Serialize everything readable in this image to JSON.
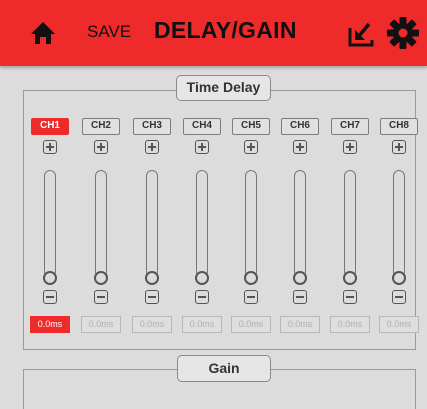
{
  "header": {
    "save_label": "SAVE",
    "title": "DELAY/GAIN",
    "icons": [
      "home-icon",
      "import-icon",
      "gear-icon"
    ],
    "accent_color": "#ee2a2a"
  },
  "time_delay": {
    "label": "Time Delay",
    "channels": [
      {
        "label": "CH1",
        "value": "0.0ms",
        "active": true,
        "level": 0
      },
      {
        "label": "CH2",
        "value": "0.0ms",
        "active": false,
        "level": 0
      },
      {
        "label": "CH3",
        "value": "0.0ms",
        "active": false,
        "level": 0
      },
      {
        "label": "CH4",
        "value": "0.0ms",
        "active": false,
        "level": 0
      },
      {
        "label": "CH5",
        "value": "0.0ms",
        "active": false,
        "level": 0
      },
      {
        "label": "CH6",
        "value": "0.0ms",
        "active": false,
        "level": 0
      },
      {
        "label": "CH7",
        "value": "0.0ms",
        "active": false,
        "level": 0
      },
      {
        "label": "CH8",
        "value": "0.0ms",
        "active": false,
        "level": 0
      }
    ]
  },
  "gain": {
    "label": "Gain"
  }
}
